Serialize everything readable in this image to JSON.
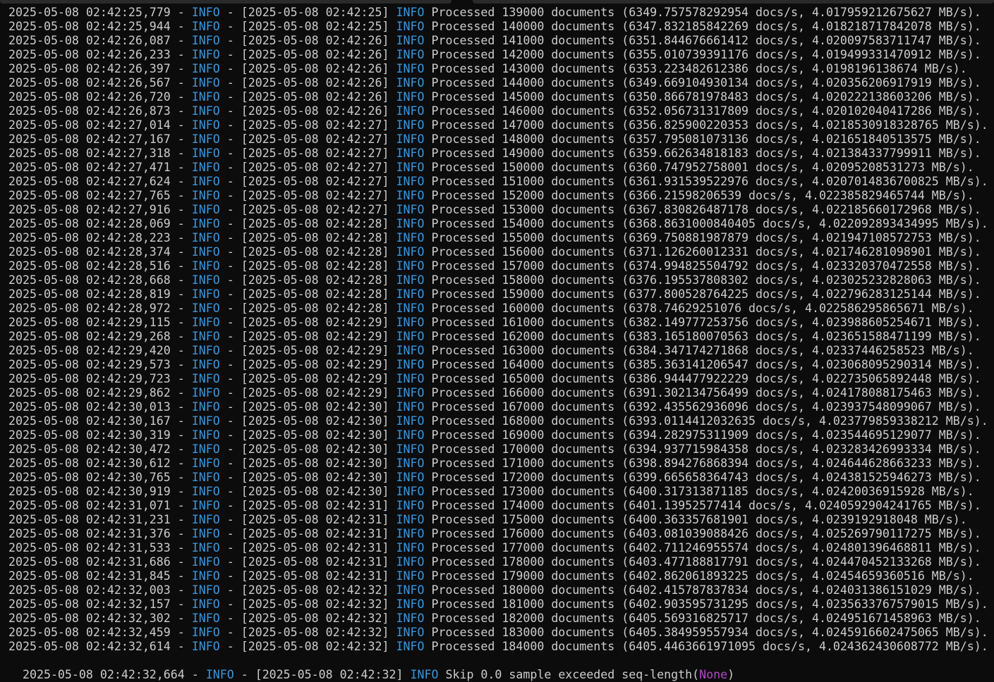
{
  "terminal": {
    "lines": [
      {
        "ts": "2025-05-08 02:42:25,779",
        "level": "INFO",
        "bracket": "[2025-05-08 02:42:25]",
        "tag": "INFO",
        "msg": "Processed 139000 documents (6349.757578292954 docs/s, 4.017959212675627 MB/s)."
      },
      {
        "ts": "2025-05-08 02:42:25,944",
        "level": "INFO",
        "bracket": "[2025-05-08 02:42:25]",
        "tag": "INFO",
        "msg": "Processed 140000 documents (6347.832185842269 docs/s, 4.01821871784207​8 MB/s)."
      },
      {
        "ts": "2025-05-08 02:42:26,087",
        "level": "INFO",
        "bracket": "[2025-05-08 02:42:26]",
        "tag": "INFO",
        "msg": "Processed 141000 documents (6351.844676661412 docs/s, 4.020097583711747 MB/s)."
      },
      {
        "ts": "2025-05-08 02:42:26,233",
        "level": "INFO",
        "bracket": "[2025-05-08 02:42:26]",
        "tag": "INFO",
        "msg": "Processed 142000 documents (6355.010739391176 docs/s, 4.019499331470912 MB/s)."
      },
      {
        "ts": "2025-05-08 02:42:26,397",
        "level": "INFO",
        "bracket": "[2025-05-08 02:42:26]",
        "tag": "INFO",
        "msg": "Processed 143000 documents (6353.223482612386 docs/s, 4.0198196138674 MB/s)."
      },
      {
        "ts": "2025-05-08 02:42:26,567",
        "level": "INFO",
        "bracket": "[2025-05-08 02:42:26]",
        "tag": "INFO",
        "msg": "Processed 144000 documents (6349.669104930134 docs/s, 4.020356206917919 MB/s)."
      },
      {
        "ts": "2025-05-08 02:42:26,720",
        "level": "INFO",
        "bracket": "[2025-05-08 02:42:26]",
        "tag": "INFO",
        "msg": "Processed 145000 documents (6350.866781978483 docs/s, 4.020222138603206 MB/s)."
      },
      {
        "ts": "2025-05-08 02:42:26,873",
        "level": "INFO",
        "bracket": "[2025-05-08 02:42:26]",
        "tag": "INFO",
        "msg": "Processed 146000 documents (6352.056731317809 docs/s, 4.020102040417286 MB/s)."
      },
      {
        "ts": "2025-05-08 02:42:27,014",
        "level": "INFO",
        "bracket": "[2025-05-08 02:42:27]",
        "tag": "INFO",
        "msg": "Processed 147000 documents (6356.825900220353 docs/s, 4.021853091832876​5 MB/s)."
      },
      {
        "ts": "2025-05-08 02:42:27,167",
        "level": "INFO",
        "bracket": "[2025-05-08 02:42:27]",
        "tag": "INFO",
        "msg": "Processed 148000 documents (6357.795081073136 docs/s, 4.021651840513575 MB/s)."
      },
      {
        "ts": "2025-05-08 02:42:27,318",
        "level": "INFO",
        "bracket": "[2025-05-08 02:42:27]",
        "tag": "INFO",
        "msg": "Processed 149000 documents (6359.662634818183 docs/s, 4.021384337799911 MB/s)."
      },
      {
        "ts": "2025-05-08 02:42:27,471",
        "level": "INFO",
        "bracket": "[2025-05-08 02:42:27]",
        "tag": "INFO",
        "msg": "Processed 150000 documents (6360.747952758001 docs/s, 4.02095208531273 MB/s)."
      },
      {
        "ts": "2025-05-08 02:42:27,624",
        "level": "INFO",
        "bracket": "[2025-05-08 02:42:27]",
        "tag": "INFO",
        "msg": "Processed 151000 documents (6361.931539522976 docs/s, 4.0207014836700825 MB/s)."
      },
      {
        "ts": "2025-05-08 02:42:27,765",
        "level": "INFO",
        "bracket": "[2025-05-08 02:42:27]",
        "tag": "INFO",
        "msg": "Processed 152000 documents (6366.21598206539 docs/s, 4.022385829465744 MB/s)."
      },
      {
        "ts": "2025-05-08 02:42:27,916",
        "level": "INFO",
        "bracket": "[2025-05-08 02:42:27]",
        "tag": "INFO",
        "msg": "Processed 153000 documents (6367.830826487178 docs/s, 4.022185660172968 MB/s)."
      },
      {
        "ts": "2025-05-08 02:42:28,069",
        "level": "INFO",
        "bracket": "[2025-05-08 02:42:28]",
        "tag": "INFO",
        "msg": "Processed 154000 documents (6368.8631000840405 docs/s, 4.022092893434995 MB/s)."
      },
      {
        "ts": "2025-05-08 02:42:28,223",
        "level": "INFO",
        "bracket": "[2025-05-08 02:42:28]",
        "tag": "INFO",
        "msg": "Processed 155000 documents (6369.750881987879 docs/s, 4.021947108572753 MB/s)."
      },
      {
        "ts": "2025-05-08 02:42:28,374",
        "level": "INFO",
        "bracket": "[2025-05-08 02:42:28]",
        "tag": "INFO",
        "msg": "Processed 156000 documents (6371.126260012331 docs/s, 4.021746281098901 MB/s)."
      },
      {
        "ts": "2025-05-08 02:42:28,516",
        "level": "INFO",
        "bracket": "[2025-05-08 02:42:28]",
        "tag": "INFO",
        "msg": "Processed 157000 documents (6374.994825504792 docs/s, 4.023320370472558 MB/s)."
      },
      {
        "ts": "2025-05-08 02:42:28,668",
        "level": "INFO",
        "bracket": "[2025-05-08 02:42:28]",
        "tag": "INFO",
        "msg": "Processed 158000 documents (6376.195537808302 docs/s, 4.023025232828063 MB/s)."
      },
      {
        "ts": "2025-05-08 02:42:28,819",
        "level": "INFO",
        "bracket": "[2025-05-08 02:42:28]",
        "tag": "INFO",
        "msg": "Processed 159000 documents (6377.800528764225 docs/s, 4.022796283125144 MB/s)."
      },
      {
        "ts": "2025-05-08 02:42:28,972",
        "level": "INFO",
        "bracket": "[2025-05-08 02:42:28]",
        "tag": "INFO",
        "msg": "Processed 160000 documents (6378.74629251076 docs/s, 4.022586295865671 MB/s)."
      },
      {
        "ts": "2025-05-08 02:42:29,115",
        "level": "INFO",
        "bracket": "[2025-05-08 02:42:29]",
        "tag": "INFO",
        "msg": "Processed 161000 documents (6382.149777253756 docs/s, 4.023988605254671 MB/s)."
      },
      {
        "ts": "2025-05-08 02:42:29,268",
        "level": "INFO",
        "bracket": "[2025-05-08 02:42:29]",
        "tag": "INFO",
        "msg": "Processed 162000 documents (6383.165180070563 docs/s, 4.023651588471199 MB/s)."
      },
      {
        "ts": "2025-05-08 02:42:29,420",
        "level": "INFO",
        "bracket": "[2025-05-08 02:42:29]",
        "tag": "INFO",
        "msg": "Processed 163000 documents (6384.347174271868 docs/s, 4.02337446258523 MB/s)."
      },
      {
        "ts": "2025-05-08 02:42:29,573",
        "level": "INFO",
        "bracket": "[2025-05-08 02:42:29]",
        "tag": "INFO",
        "msg": "Processed 164000 documents (6385.363141206547 docs/s, 4.023068095290314 MB/s)."
      },
      {
        "ts": "2025-05-08 02:42:29,723",
        "level": "INFO",
        "bracket": "[2025-05-08 02:42:29]",
        "tag": "INFO",
        "msg": "Processed 165000 documents (6386.944477922229 docs/s, 4.022735065892448 MB/s)."
      },
      {
        "ts": "2025-05-08 02:42:29,862",
        "level": "INFO",
        "bracket": "[2025-05-08 02:42:29]",
        "tag": "INFO",
        "msg": "Processed 166000 documents (6391.302134756499 docs/s, 4.024178088175463 MB/s)."
      },
      {
        "ts": "2025-05-08 02:42:30,013",
        "level": "INFO",
        "bracket": "[2025-05-08 02:42:30]",
        "tag": "INFO",
        "msg": "Processed 167000 documents (6392.435562936096 docs/s, 4.023937548099067 MB/s)."
      },
      {
        "ts": "2025-05-08 02:42:30,167",
        "level": "INFO",
        "bracket": "[2025-05-08 02:42:30]",
        "tag": "INFO",
        "msg": "Processed 168000 documents (6393.0114412032635 docs/s, 4.023779859338212 MB/s)."
      },
      {
        "ts": "2025-05-08 02:42:30,319",
        "level": "INFO",
        "bracket": "[2025-05-08 02:42:30]",
        "tag": "INFO",
        "msg": "Processed 169000 documents (6394.282975311909 docs/s, 4.023544695129077 MB/s)."
      },
      {
        "ts": "2025-05-08 02:42:30,472",
        "level": "INFO",
        "bracket": "[2025-05-08 02:42:30]",
        "tag": "INFO",
        "msg": "Processed 170000 documents (6394.937715984358 docs/s, 4.023283426993334 MB/s)."
      },
      {
        "ts": "2025-05-08 02:42:30,612",
        "level": "INFO",
        "bracket": "[2025-05-08 02:42:30]",
        "tag": "INFO",
        "msg": "Processed 171000 documents (6398.894276868394 docs/s, 4.024644628663233 MB/s)."
      },
      {
        "ts": "2025-05-08 02:42:30,765",
        "level": "INFO",
        "bracket": "[2025-05-08 02:42:30]",
        "tag": "INFO",
        "msg": "Processed 172000 documents (6399.665658364743 docs/s, 4.024381525946273 MB/s)."
      },
      {
        "ts": "2025-05-08 02:42:30,919",
        "level": "INFO",
        "bracket": "[2025-05-08 02:42:30]",
        "tag": "INFO",
        "msg": "Processed 173000 documents (6400.317313871185 docs/s, 4.02420036915928 MB/s)."
      },
      {
        "ts": "2025-05-08 02:42:31,071",
        "level": "INFO",
        "bracket": "[2025-05-08 02:42:31]",
        "tag": "INFO",
        "msg": "Processed 174000 documents (6401.13952577414 docs/s, 4.0240592904241765 MB/s)."
      },
      {
        "ts": "2025-05-08 02:42:31,231",
        "level": "INFO",
        "bracket": "[2025-05-08 02:42:31]",
        "tag": "INFO",
        "msg": "Processed 175000 documents (6400.363357681901 docs/s, 4.0239192918048 MB/s)."
      },
      {
        "ts": "2025-05-08 02:42:31,376",
        "level": "INFO",
        "bracket": "[2025-05-08 02:42:31]",
        "tag": "INFO",
        "msg": "Processed 176000 documents (6403.081039088426 docs/s, 4.025269790117275 MB/s)."
      },
      {
        "ts": "2025-05-08 02:42:31,533",
        "level": "INFO",
        "bracket": "[2025-05-08 02:42:31]",
        "tag": "INFO",
        "msg": "Processed 177000 documents (6402.711246955574 docs/s, 4.024801396468811 MB/s)."
      },
      {
        "ts": "2025-05-08 02:42:31,686",
        "level": "INFO",
        "bracket": "[2025-05-08 02:42:31]",
        "tag": "INFO",
        "msg": "Processed 178000 documents (6403.477188817791 docs/s, 4.024470452133268 MB/s)."
      },
      {
        "ts": "2025-05-08 02:42:31,845",
        "level": "INFO",
        "bracket": "[2025-05-08 02:42:31]",
        "tag": "INFO",
        "msg": "Processed 179000 documents (6402.862061893225 docs/s, 4.02454659360516 MB/s)."
      },
      {
        "ts": "2025-05-08 02:42:32,003",
        "level": "INFO",
        "bracket": "[2025-05-08 02:42:32]",
        "tag": "INFO",
        "msg": "Processed 180000 documents (6402.415787837834 docs/s, 4.024031386151029 MB/s)."
      },
      {
        "ts": "2025-05-08 02:42:32,157",
        "level": "INFO",
        "bracket": "[2025-05-08 02:42:32]",
        "tag": "INFO",
        "msg": "Processed 181000 documents (6402.903595731295 docs/s, 4.0235633767579015 MB/s)."
      },
      {
        "ts": "2025-05-08 02:42:32,302",
        "level": "INFO",
        "bracket": "[2025-05-08 02:42:32]",
        "tag": "INFO",
        "msg": "Processed 182000 documents (6405.569316825717 docs/s, 4.024951671458963 MB/s)."
      },
      {
        "ts": "2025-05-08 02:42:32,459",
        "level": "INFO",
        "bracket": "[2025-05-08 02:42:32]",
        "tag": "INFO",
        "msg": "Processed 183000 documents (6405.384959557934 docs/s, 4.0245916602475065 MB/s)."
      },
      {
        "ts": "2025-05-08 02:42:32,614",
        "level": "INFO",
        "bracket": "[2025-05-08 02:42:32]",
        "tag": "INFO",
        "msg": "Processed 184000 documents (6405.4463661971095 docs/s, 4.024362430608772 MB/s)."
      }
    ],
    "last_line": {
      "ts": "2025-05-08 02:42:32,664",
      "level": "INFO",
      "bracket": "[2025-05-08 02:42:32]",
      "tag": "INFO",
      "msg": "Skip 0.0 sample exceeded seq-length(",
      "none": "None",
      "close": ")"
    },
    "separator": " - ",
    "colors": {
      "background": "#0c0c0c",
      "text": "#cccccc",
      "info": "#3a96dd",
      "none": "#b148c6"
    }
  }
}
